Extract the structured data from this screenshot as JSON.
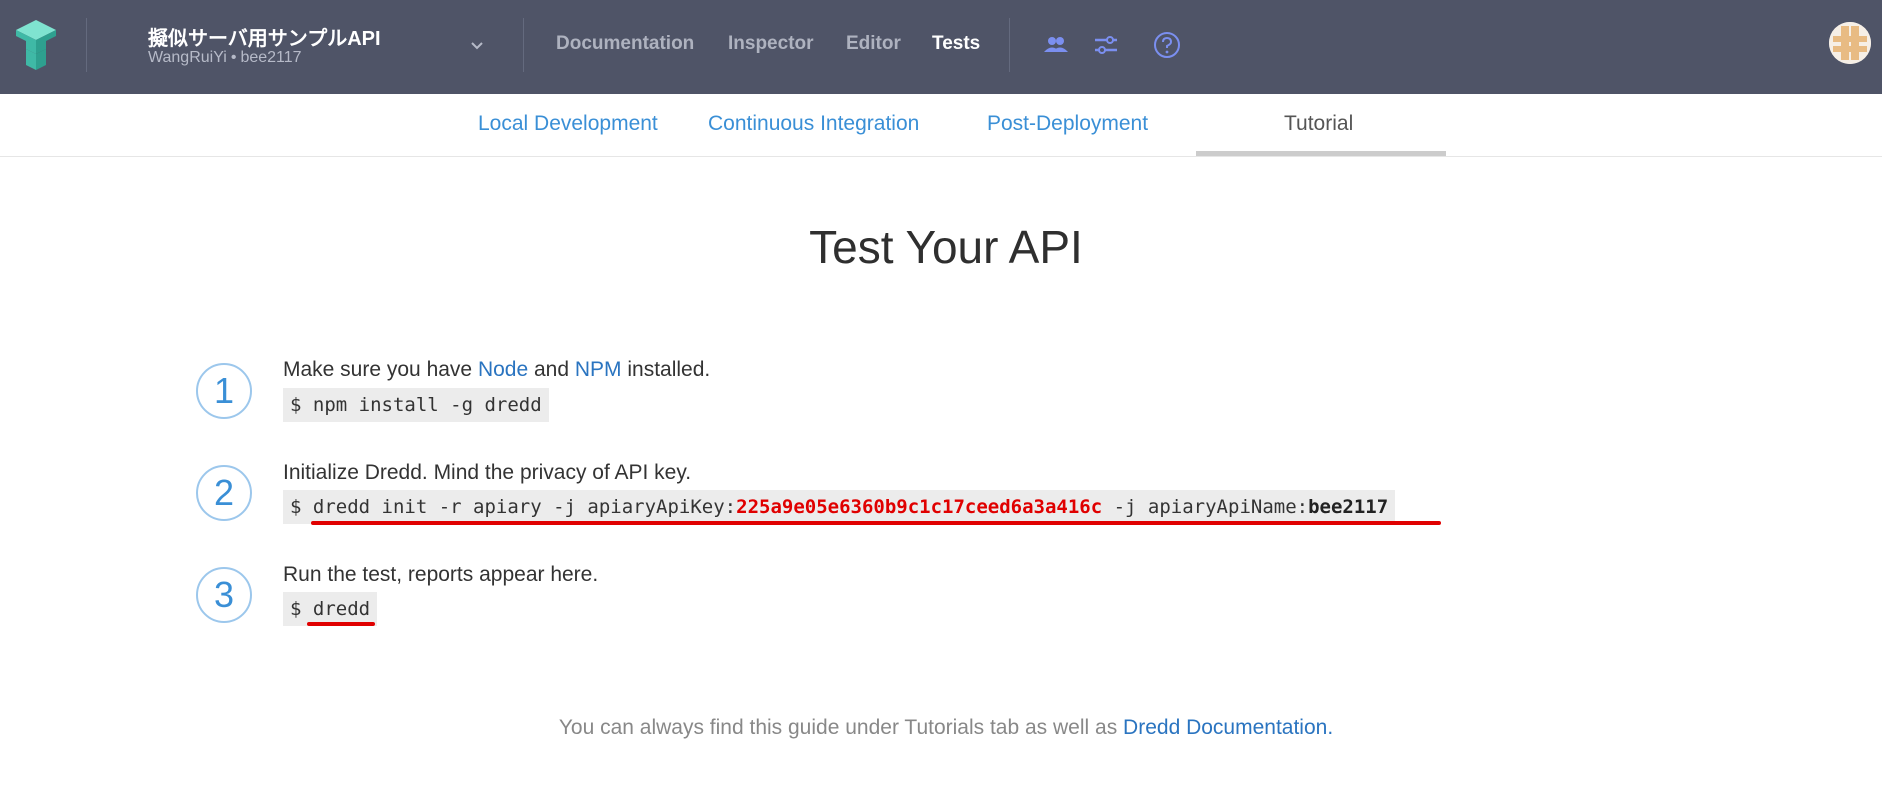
{
  "header": {
    "project_title": "擬似サーバ用サンプルAPI",
    "owner": "WangRuiYi",
    "separator": "•",
    "project_id": "bee2117",
    "nav": [
      "Documentation",
      "Inspector",
      "Editor",
      "Tests"
    ],
    "active_nav": "Tests",
    "icons": [
      "logo-icon",
      "chevron-down-icon",
      "team-icon",
      "settings-sliders-icon",
      "help-icon",
      "avatar"
    ]
  },
  "tabs": {
    "items": [
      "Local Development",
      "Continuous Integration",
      "Post-Deployment",
      "Tutorial"
    ],
    "active": "Tutorial"
  },
  "main": {
    "title": "Test Your API",
    "steps": [
      {
        "number": "1",
        "text_before": "Make sure you have ",
        "link1": "Node",
        "text_mid": " and ",
        "link2": "NPM",
        "text_after": " installed.",
        "command": "$ npm install -g dredd"
      },
      {
        "number": "2",
        "text": "Initialize Dredd. Mind the privacy of API key.",
        "command_prefix": "$ dredd init -r apiary -j apiaryApiKey:",
        "api_key": "225a9e05e6360b9c1c17ceed6a3a416c",
        "command_mid": " -j apiaryApiName:",
        "api_name": "bee2117"
      },
      {
        "number": "3",
        "text": "Run the test, reports appear here.",
        "command": "$ dredd"
      }
    ],
    "footer_text": "You can always find this guide under Tutorials tab as well as ",
    "footer_link": "Dredd Documentation",
    "footer_end": "."
  },
  "colors": {
    "topbar": "#4f5467",
    "link": "#2a74c0",
    "annotation": "#e00000"
  }
}
